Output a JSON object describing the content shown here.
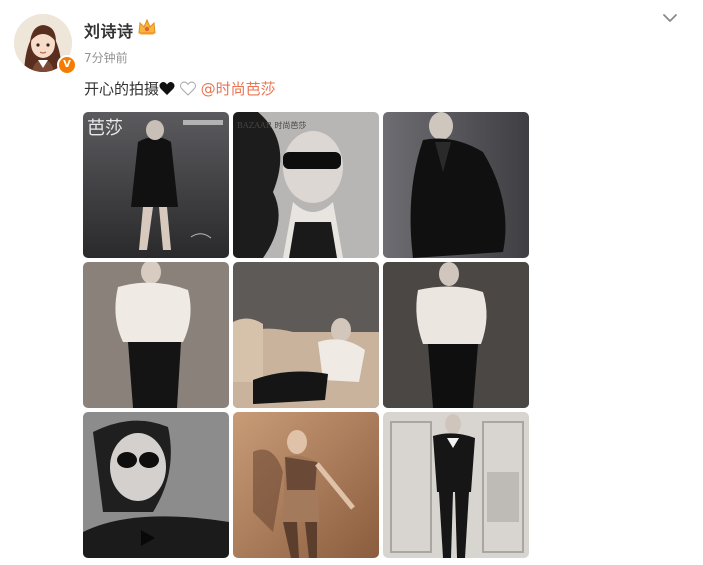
{
  "post": {
    "username": "刘诗诗",
    "timestamp": "7分钟前",
    "text_prefix": "开心的拍摄",
    "mention": "@时尚芭莎",
    "verified_mark": "V",
    "icons": {
      "verified": "verified-badge-icon",
      "crown": "crown-icon",
      "more": "chevron-down-icon",
      "black_heart": "black-heart-icon",
      "white_heart": "white-heart-icon"
    },
    "colors": {
      "mention": "#eb7350",
      "verified": "#f57c00",
      "timestamp": "#939393"
    }
  },
  "photos": {
    "magazine_cover_title": "芭莎",
    "photo2_watermark": "BAZAAR\n时尚芭莎"
  }
}
